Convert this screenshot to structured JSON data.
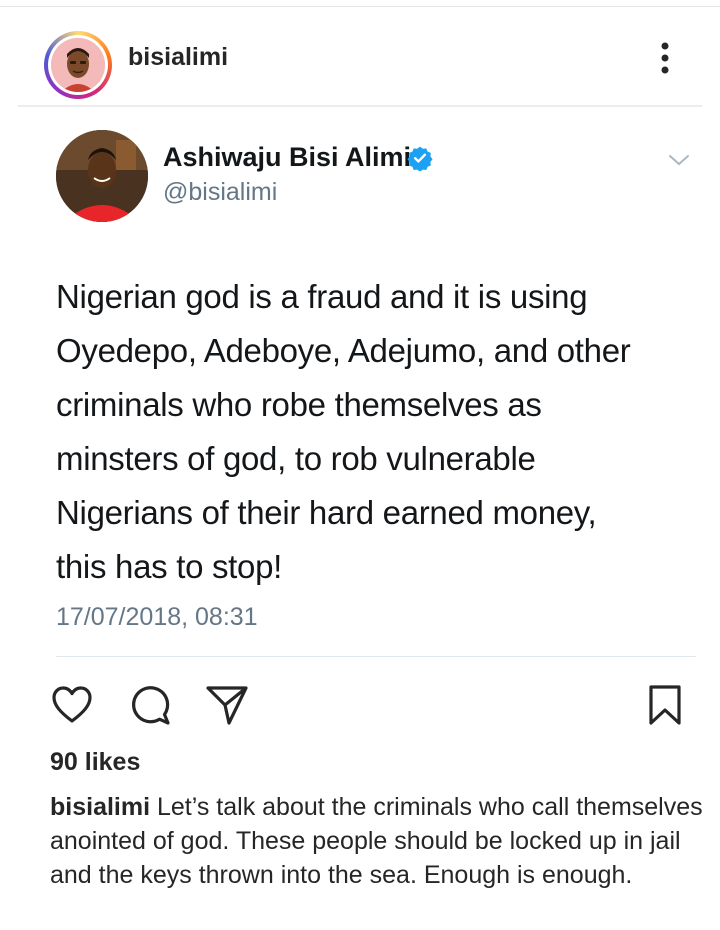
{
  "post": {
    "username": "bisialimi",
    "likes": "90 likes",
    "caption_user": "bisialimi",
    "caption_text": "Let’s talk about the criminals who call themselves anointed of god. These people should be locked up in jail and the keys thrown into the sea. Enough is enough."
  },
  "tweet": {
    "display_name": "Ashiwaju Bisi Alimi",
    "handle": "@bisialimi",
    "text": "Nigerian god is a fraud and it is using\nOyedepo, Adeboye, Adejumo, and other\ncriminals who robe themselves as\nminsters of god, to rob vulnerable\nNigerians of their hard earned money,\nthis has to stop!",
    "timestamp": "17/07/2018, 08:31"
  },
  "icons": {
    "more": "more-options-icon",
    "verified": "verified-badge-icon",
    "caret": "chevron-down-icon",
    "like": "heart-icon",
    "comment": "comment-icon",
    "share": "share-icon",
    "save": "bookmark-icon"
  },
  "colors": {
    "verified": "#1da1f2",
    "text": "#262626",
    "secondary": "#657786"
  }
}
